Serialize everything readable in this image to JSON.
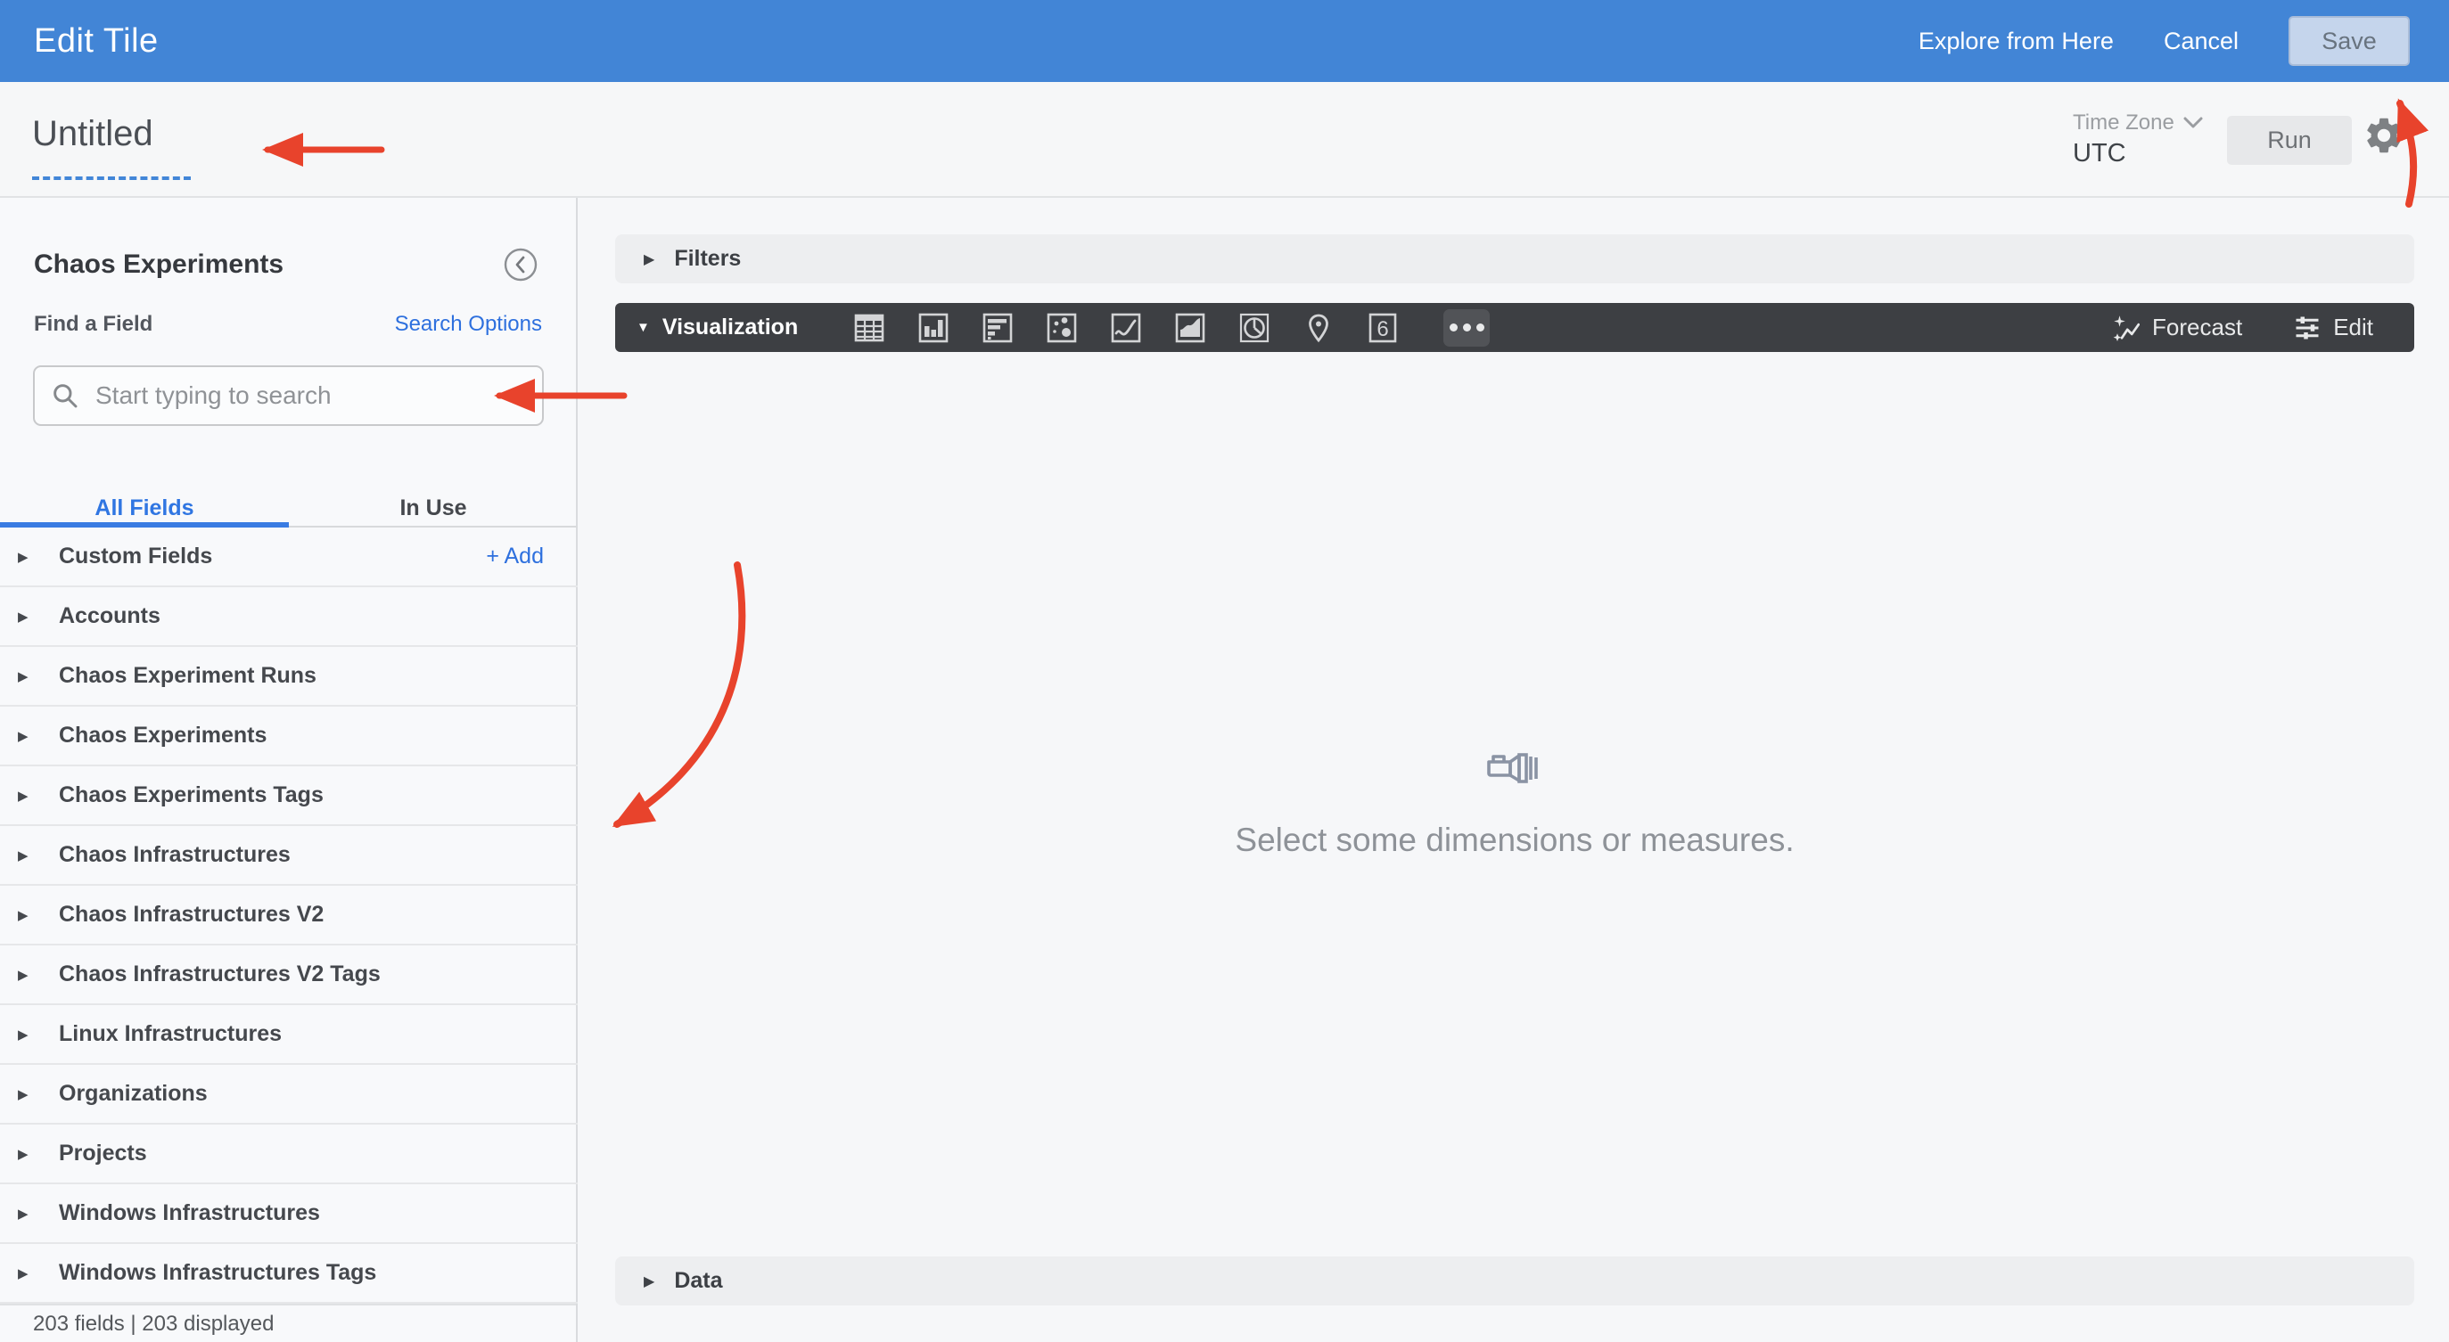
{
  "topbar": {
    "title": "Edit Tile",
    "explore_label": "Explore from Here",
    "cancel_label": "Cancel",
    "save_label": "Save"
  },
  "toolbar": {
    "tile_title": "Untitled",
    "timezone_label": "Time Zone",
    "timezone_value": "UTC",
    "run_label": "Run"
  },
  "sidebar": {
    "title": "Chaos Experiments",
    "find_label": "Find a Field",
    "search_options_label": "Search Options",
    "search_placeholder": "Start typing to search",
    "search_value": "",
    "tabs": [
      {
        "label": "All Fields",
        "active": true
      },
      {
        "label": "In Use",
        "active": false
      }
    ],
    "custom_fields": {
      "label": "Custom Fields",
      "add_label": "+ Add"
    },
    "groups": [
      "Accounts",
      "Chaos Experiment Runs",
      "Chaos Experiments",
      "Chaos Experiments Tags",
      "Chaos Infrastructures",
      "Chaos Infrastructures V2",
      "Chaos Infrastructures V2 Tags",
      "Linux Infrastructures",
      "Organizations",
      "Projects",
      "Windows Infrastructures",
      "Windows Infrastructures Tags"
    ],
    "footer": "203 fields | 203 displayed"
  },
  "main": {
    "filters_label": "Filters",
    "data_label": "Data",
    "visualization": {
      "label": "Visualization",
      "single_value_glyph": "6",
      "forecast_label": "Forecast",
      "edit_label": "Edit",
      "type_icons": [
        "table-icon",
        "column-chart-icon",
        "bar-chart-icon",
        "scatter-chart-icon",
        "line-chart-icon",
        "area-chart-icon",
        "pie-chart-icon",
        "map-pin-icon",
        "single-value-icon",
        "more-options-icon"
      ]
    },
    "empty_state_text": "Select some dimensions or measures."
  },
  "colors": {
    "topbar_blue": "#4285d6",
    "link_blue": "#2e70de",
    "active_tab_blue": "#3076e2",
    "dark_bar": "#3d3f43",
    "annotation_red": "#e8432c"
  }
}
